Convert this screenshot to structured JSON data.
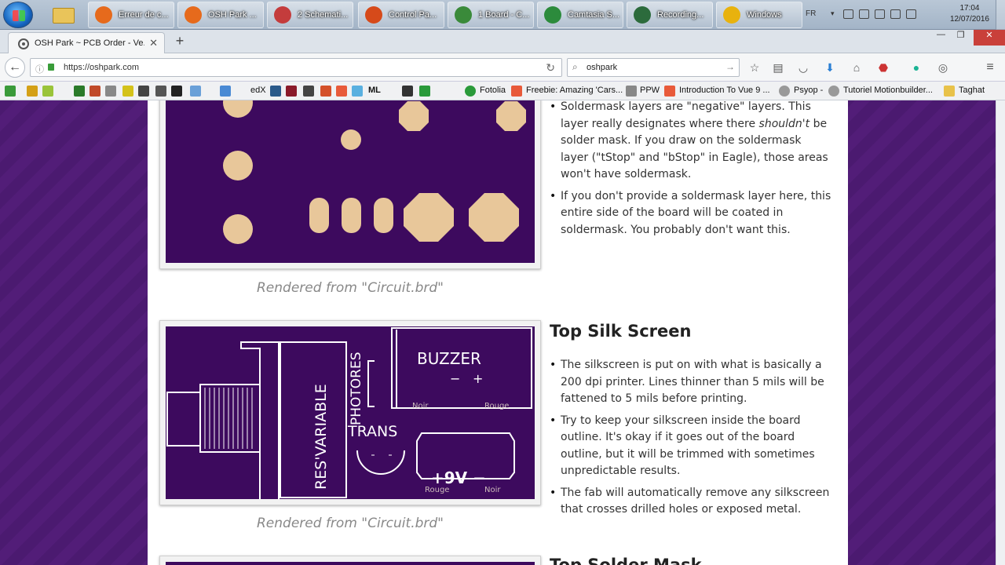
{
  "taskbar": {
    "items": [
      {
        "label": "Erreur de c...",
        "color": "#e66a1c"
      },
      {
        "label": "OSH Park ...",
        "color": "#e66a1c"
      },
      {
        "label": "2 Schemati...",
        "color": "#c43c3c"
      },
      {
        "label": "Control Pa...",
        "color": "#d64a1a"
      },
      {
        "label": "1 Board - C...",
        "color": "#3a8a3a"
      },
      {
        "label": "Camtasia S...",
        "color": "#2c8b3c"
      },
      {
        "label": "Recording...",
        "color": "#2c6b3c"
      },
      {
        "label": "Windows",
        "color": "#e8b20e"
      }
    ],
    "language": "FR",
    "time": "17:04",
    "date": "12/07/2016"
  },
  "browser": {
    "tab_title": "OSH Park ~ PCB Order - Ve...",
    "url": "https://oshpark.com",
    "search_query": "oshpark",
    "bookmarks": [
      {
        "label": "edX"
      },
      {
        "label": "ML"
      },
      {
        "label": "Fotolia"
      },
      {
        "label": "Freebie: Amazing 'Cars..."
      },
      {
        "label": "PPW"
      },
      {
        "label": "Introduction To Vue 9 ..."
      },
      {
        "label": "Psyop -"
      },
      {
        "label": "Tutoriel Motionbuilder..."
      },
      {
        "label": "Taghat"
      }
    ]
  },
  "page": {
    "section1": {
      "bullets": [
        [
          "Soldermask layers are \"negative\" layers. This layer really designates where there ",
          "shouldn't",
          " be solder mask. If you draw on the soldermask layer (\"tStop\" and \"bStop\" in Eagle), those areas won't have soldermask."
        ],
        [
          "If you don't provide a soldermask layer here, this entire side of the board will be coated in soldermask. You probably don't want this."
        ]
      ],
      "caption": "Rendered from \"Circuit.brd\""
    },
    "section2": {
      "heading": "Top Silk Screen",
      "bullets": [
        "The silkscreen is put on with what is basically a 200 dpi printer. Lines thinner than 5 mils will be fattened to 5 mils before printing.",
        "Try to keep your silkscreen inside the board outline. It's okay if it goes out of the board outline, but it will be trimmed with sometimes unpredictable results.",
        "The fab will automatically remove any silkscreen that crosses drilled holes or exposed metal."
      ],
      "caption": "Rendered from \"Circuit.brd\"",
      "silk_labels": {
        "buzzer": "BUZZER",
        "minus": "−",
        "plus": "+",
        "noir1": "Noir",
        "rouge1": "Rouge",
        "photores": "PHOTORES",
        "trans": "TRANS",
        "resvariable": "RES'VARIABLE",
        "battery": "+9V −",
        "rouge2": "Rouge",
        "noir2": "Noir"
      }
    },
    "section3": {
      "heading": "Top Solder Mask"
    }
  },
  "colors": {
    "board_purple": "#3d0a5e",
    "pad_copper": "#e8c79a",
    "page_bg": "#4a1a6e"
  }
}
